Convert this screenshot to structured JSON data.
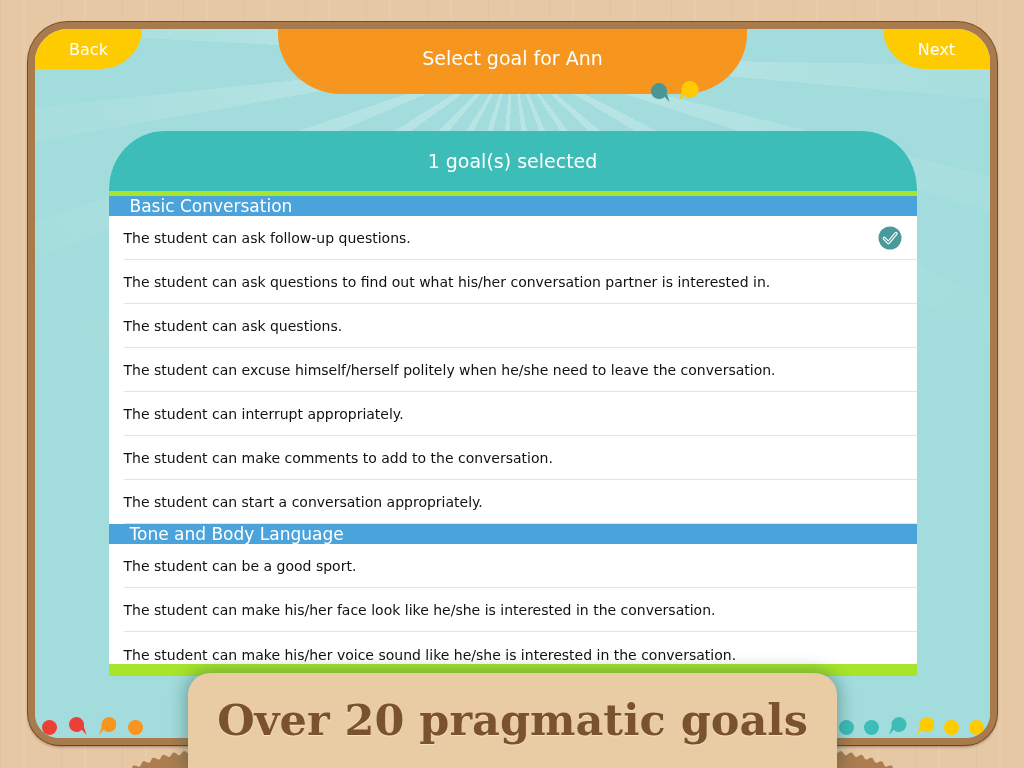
{
  "top_bar": {
    "back_button": "Back",
    "title": "Select goal for Ann",
    "next_button": "Next"
  },
  "goal_list": {
    "header": "1 goal(s) selected",
    "sections": [
      {
        "title": "Basic Conversation",
        "goals": [
          {
            "text": "The student can ask follow-up questions.",
            "selected": true
          },
          {
            "text": "The student can ask questions to find out what his/her conversation partner is interested in.",
            "selected": false
          },
          {
            "text": "The student can ask questions.",
            "selected": false
          },
          {
            "text": "The student can excuse himself/herself politely when he/she need to leave the conversation.",
            "selected": false
          },
          {
            "text": "The student can interrupt appropriately.",
            "selected": false
          },
          {
            "text": "The student can make comments to add to the conversation.",
            "selected": false
          },
          {
            "text": "The student can start a conversation appropriately.",
            "selected": false
          }
        ]
      },
      {
        "title": "Tone and Body Language",
        "goals": [
          {
            "text": "The student can be a good sport.",
            "selected": false
          },
          {
            "text": "The student can make his/her face look like he/she is interested in the conversation.",
            "selected": false
          },
          {
            "text": "The student can make his/her voice sound like he/she is interested in the conversation.",
            "selected": false
          }
        ]
      }
    ]
  },
  "banner": {
    "text": "Over 20 pragmatic goals"
  }
}
